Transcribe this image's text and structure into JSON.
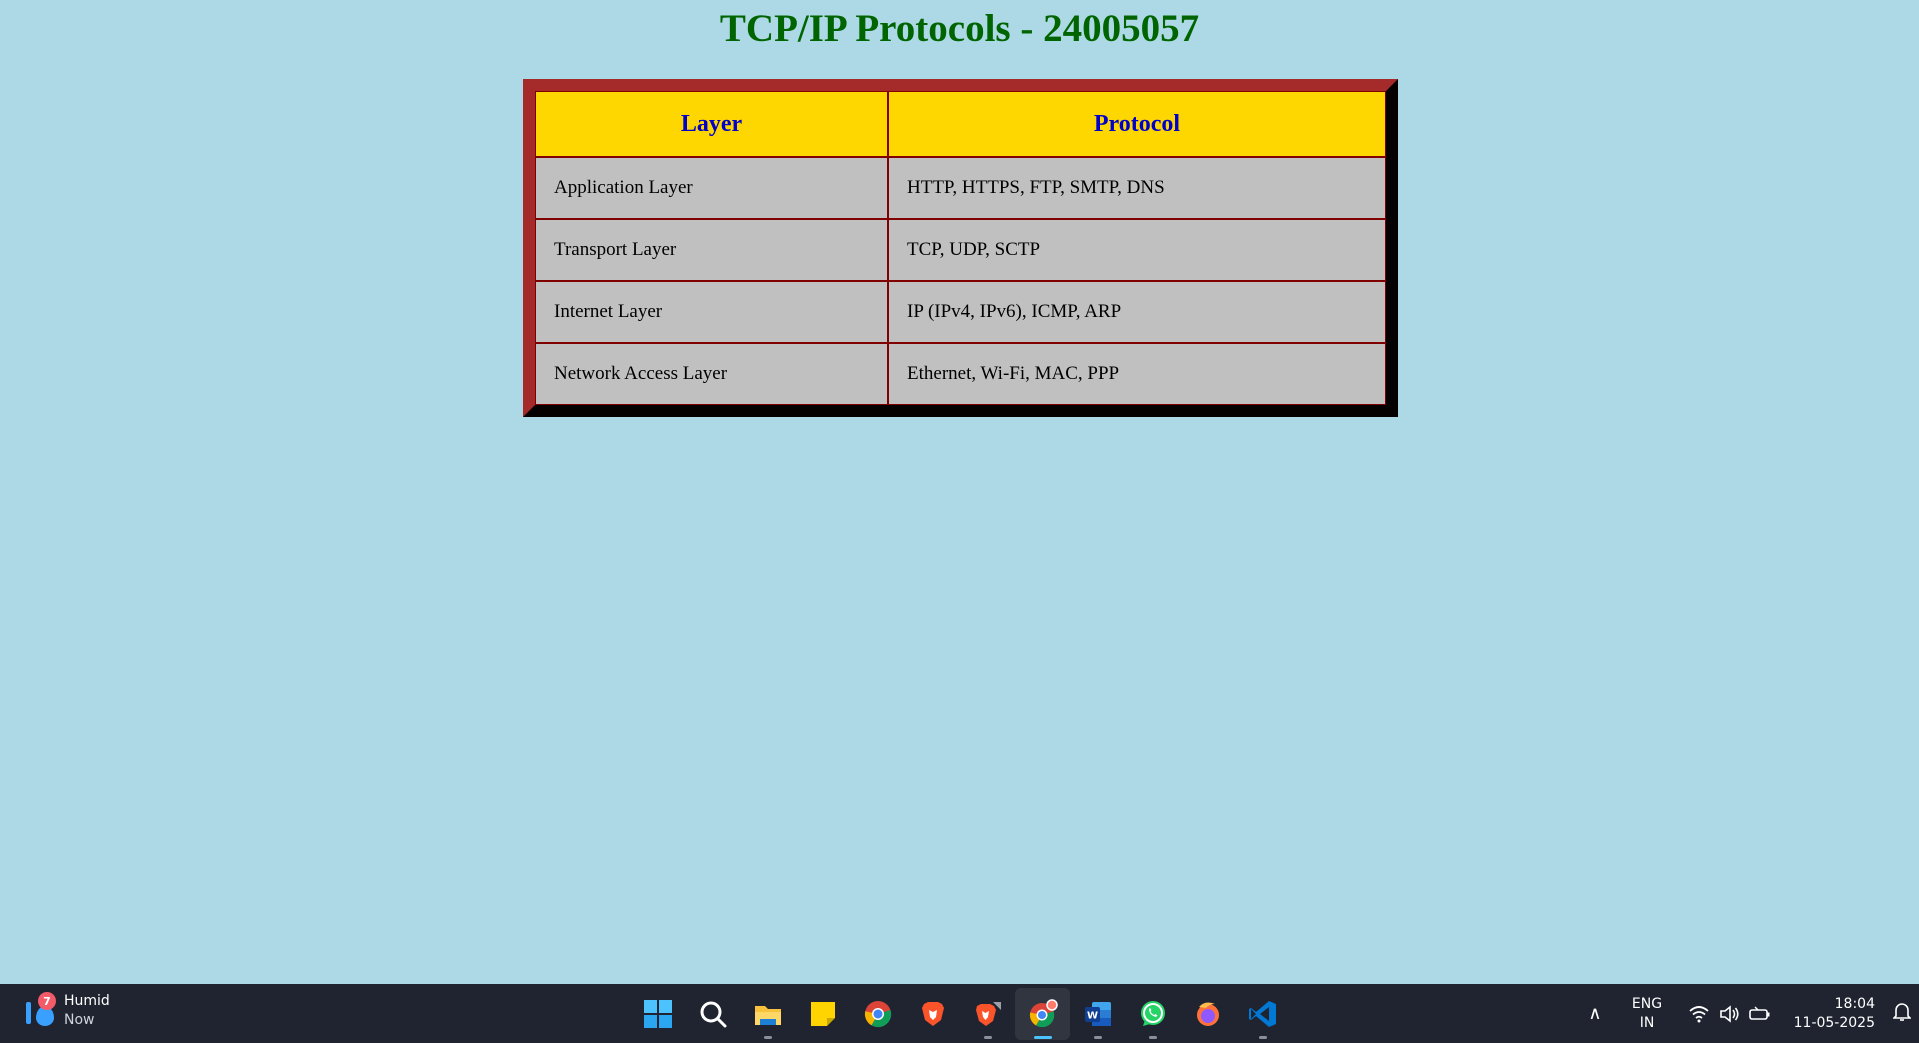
{
  "page": {
    "title": "TCP/IP Protocols - 24005057"
  },
  "table": {
    "headers": [
      "Layer",
      "Protocol"
    ],
    "rows": [
      {
        "layer": "Application Layer",
        "protocol": "HTTP, HTTPS, FTP, SMTP, DNS"
      },
      {
        "layer": "Transport Layer",
        "protocol": "TCP, UDP, SCTP"
      },
      {
        "layer": "Internet Layer",
        "protocol": "IP (IPv4, IPv6), ICMP, ARP"
      },
      {
        "layer": "Network Access Layer",
        "protocol": "Ethernet, Wi-Fi, MAC, PPP"
      }
    ]
  },
  "colors": {
    "page_background": "#add8e6",
    "title": "#006400",
    "header_background": "#ffd700",
    "header_text": "#0000cd",
    "cell_background": "#c0c0c0",
    "table_border": "#a52a2a"
  },
  "taskbar": {
    "weather": {
      "label": "Humid",
      "sub": "Now",
      "badge": "7"
    },
    "apps": [
      {
        "name": "start-icon"
      },
      {
        "name": "search-icon"
      },
      {
        "name": "file-explorer-icon"
      },
      {
        "name": "sticky-notes-icon"
      },
      {
        "name": "chrome-icon"
      },
      {
        "name": "brave-icon"
      },
      {
        "name": "brave-beta-icon"
      },
      {
        "name": "chrome-canary-icon",
        "active": true
      },
      {
        "name": "word-icon"
      },
      {
        "name": "whatsapp-icon"
      },
      {
        "name": "firefox-icon"
      },
      {
        "name": "vscode-icon"
      }
    ],
    "language": {
      "line1": "ENG",
      "line2": "IN"
    },
    "clock": {
      "time": "18:04",
      "date": "11-05-2025"
    }
  }
}
